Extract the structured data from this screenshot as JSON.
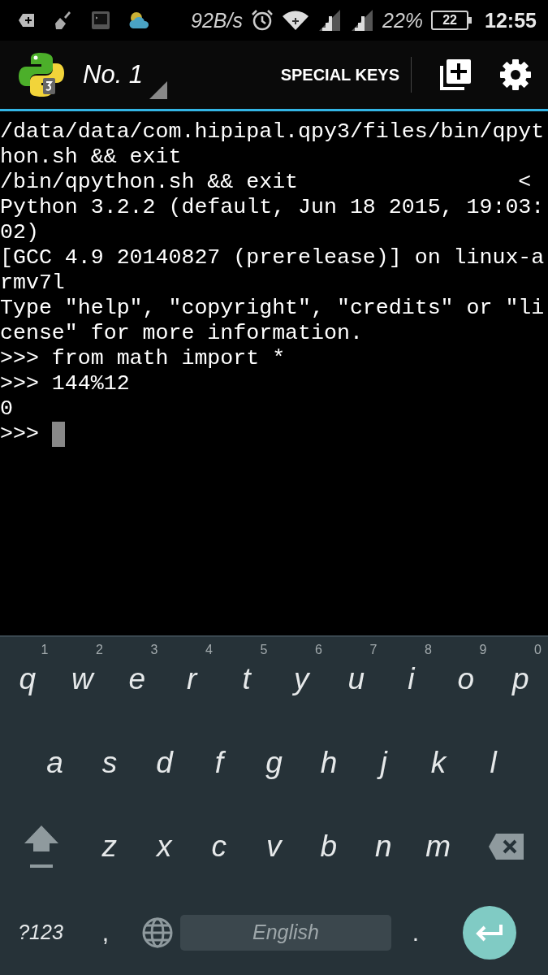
{
  "status_bar": {
    "net_speed": "92B/s",
    "battery_percent": "22%",
    "battery_badge": "22",
    "time": "12:55"
  },
  "toolbar": {
    "session": "No. 1",
    "special_keys": "SPECIAL KEYS"
  },
  "terminal": {
    "lines": [
      "/data/data/com.hipipal.qpy3/files/bin/qpyt",
      "hon.sh && exit",
      "/bin/qpython.sh && exit                 <",
      "Python 3.2.2 (default, Jun 18 2015, 19:03:",
      "02)",
      "[GCC 4.9 20140827 (prerelease)] on linux-a",
      "rmv7l",
      "Type \"help\", \"copyright\", \"credits\" or \"li",
      "cense\" for more information.",
      ">>> from math import *",
      ">>> 144%12",
      "0",
      ">>> "
    ],
    "cursor": true
  },
  "keyboard": {
    "rows": [
      [
        {
          "kind": "char",
          "label": "q",
          "hint": "1"
        },
        {
          "kind": "char",
          "label": "w",
          "hint": "2"
        },
        {
          "kind": "char",
          "label": "e",
          "hint": "3"
        },
        {
          "kind": "char",
          "label": "r",
          "hint": "4"
        },
        {
          "kind": "char",
          "label": "t",
          "hint": "5"
        },
        {
          "kind": "char",
          "label": "y",
          "hint": "6"
        },
        {
          "kind": "char",
          "label": "u",
          "hint": "7"
        },
        {
          "kind": "char",
          "label": "i",
          "hint": "8"
        },
        {
          "kind": "char",
          "label": "o",
          "hint": "9"
        },
        {
          "kind": "char",
          "label": "p",
          "hint": "0"
        }
      ],
      [
        {
          "kind": "char",
          "label": "a"
        },
        {
          "kind": "char",
          "label": "s"
        },
        {
          "kind": "char",
          "label": "d"
        },
        {
          "kind": "char",
          "label": "f"
        },
        {
          "kind": "char",
          "label": "g"
        },
        {
          "kind": "char",
          "label": "h"
        },
        {
          "kind": "char",
          "label": "j"
        },
        {
          "kind": "char",
          "label": "k"
        },
        {
          "kind": "char",
          "label": "l"
        }
      ],
      [
        {
          "kind": "shift"
        },
        {
          "kind": "char",
          "label": "z"
        },
        {
          "kind": "char",
          "label": "x"
        },
        {
          "kind": "char",
          "label": "c"
        },
        {
          "kind": "char",
          "label": "v"
        },
        {
          "kind": "char",
          "label": "b"
        },
        {
          "kind": "char",
          "label": "n"
        },
        {
          "kind": "char",
          "label": "m"
        },
        {
          "kind": "backspace"
        }
      ]
    ],
    "bottom": {
      "symbols": "?123",
      "comma": ",",
      "space": "English",
      "period": "."
    }
  }
}
